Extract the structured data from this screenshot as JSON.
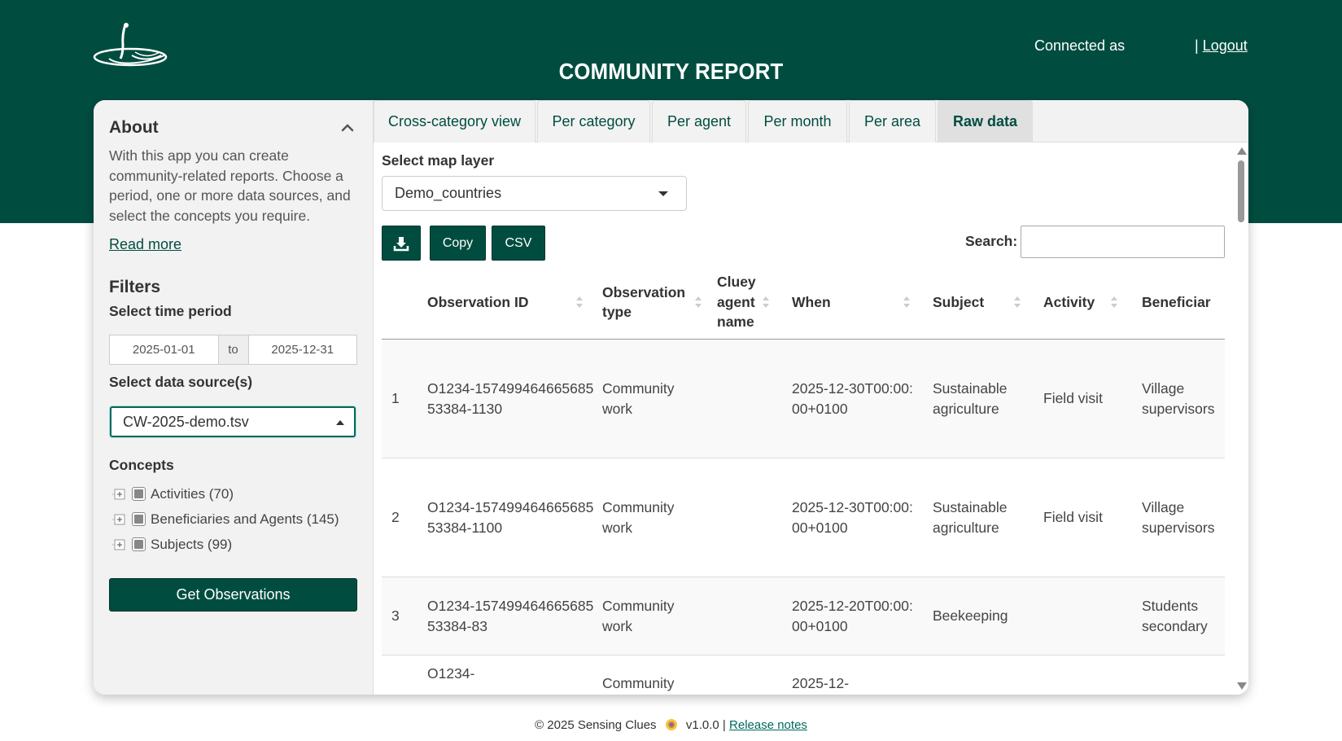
{
  "header": {
    "title": "COMMUNITY REPORT",
    "connected_label": "Connected as",
    "separator": "|",
    "logout_label": "Logout",
    "logo_icon": "meerkat-logo-icon"
  },
  "sidebar": {
    "about_title": "About",
    "about_text": "With this app you can create community-related reports. Choose a period, one or more data sources, and select the concepts you require.",
    "read_more": "Read more",
    "filters_title": "Filters",
    "time_period_label": "Select time period",
    "date_start": "2025-01-01",
    "date_sep": "to",
    "date_end": "2025-12-31",
    "data_source_label": "Select data source(s)",
    "data_source_value": "CW-2025-demo.tsv",
    "concepts_label": "Concepts",
    "concepts": [
      {
        "label": "Activities (70)"
      },
      {
        "label": "Beneficiaries and Agents (145)"
      },
      {
        "label": "Subjects (99)"
      }
    ],
    "get_button": "Get Observations"
  },
  "tabs": [
    {
      "label": "Cross-category view",
      "active": false
    },
    {
      "label": "Per category",
      "active": false
    },
    {
      "label": "Per agent",
      "active": false
    },
    {
      "label": "Per month",
      "active": false
    },
    {
      "label": "Per area",
      "active": false
    },
    {
      "label": "Raw data",
      "active": true
    }
  ],
  "raw": {
    "map_layer_label": "Select map layer",
    "map_layer_value": "Demo_countries",
    "download_icon": "download-icon",
    "copy_label": "Copy",
    "csv_label": "CSV",
    "search_label": "Search:",
    "search_value": ""
  },
  "table": {
    "columns": [
      "",
      "Observation ID",
      "Observation type",
      "Cluey agent name",
      "When",
      "Subject",
      "Activity",
      "Beneficiar"
    ],
    "rows": [
      {
        "n": "1",
        "id": "O1234-15749946466568553384-1130",
        "type": "Community work",
        "agent": "",
        "when": "2025-12-30T00:00:00+0100",
        "subject": "Sustainable agriculture",
        "activity": "Field visit",
        "beneficiary": "Village supervisors"
      },
      {
        "n": "2",
        "id": "O1234-15749946466568553384-1100",
        "type": "Community work",
        "agent": "",
        "when": "2025-12-30T00:00:00+0100",
        "subject": "Sustainable agriculture",
        "activity": "Field visit",
        "beneficiary": "Village supervisors"
      },
      {
        "n": "3",
        "id": "O1234-15749946466568553384-83",
        "type": "Community work",
        "agent": "",
        "when": "2025-12-20T00:00:00+0100",
        "subject": "Beekeeping",
        "activity": "",
        "beneficiary": "Students secondary"
      },
      {
        "n": "",
        "id": "O1234-",
        "type": "Community",
        "agent": "",
        "when": "2025-12-",
        "subject": "",
        "activity": "",
        "beneficiary": ""
      }
    ]
  },
  "footer": {
    "copyright": "© 2025 Sensing Clues",
    "version": "v1.0.0 |",
    "release_notes": "Release notes"
  },
  "colors": {
    "brand": "#004d40",
    "accent": "#00695c"
  }
}
